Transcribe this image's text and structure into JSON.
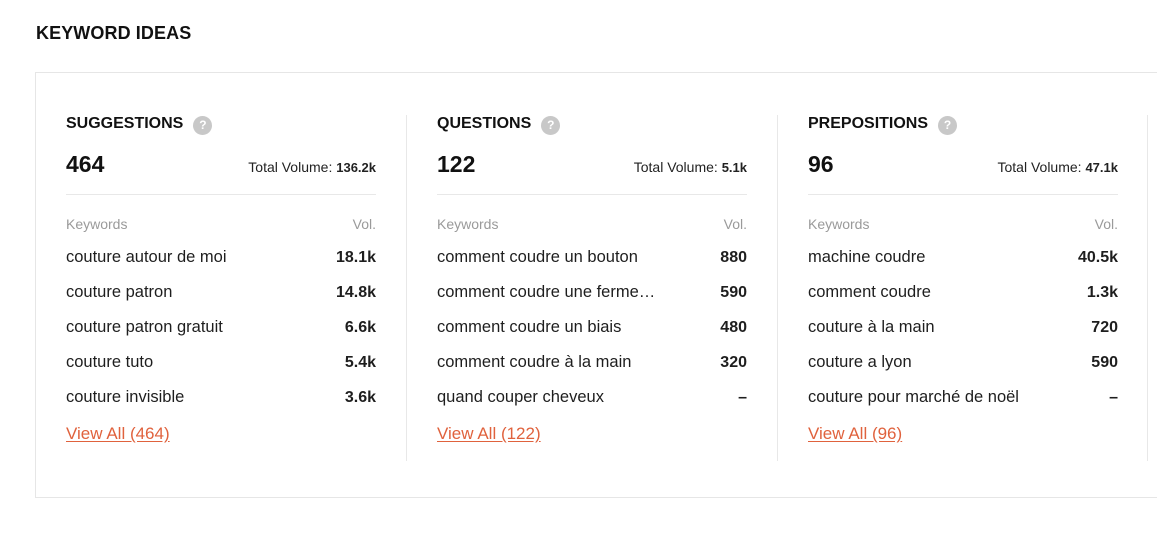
{
  "page": {
    "title": "KEYWORD IDEAS"
  },
  "common": {
    "total_label": "Total Volume:",
    "keywords_header": "Keywords",
    "vol_header": "Vol.",
    "help_glyph": "?"
  },
  "colors": {
    "link": "#e0623d",
    "help_icon": "#c8c8c8"
  },
  "columns": [
    {
      "title": "SUGGESTIONS",
      "count": "464",
      "total_volume": "136.2k",
      "rows": [
        {
          "keyword": "couture autour de moi",
          "volume": "18.1k"
        },
        {
          "keyword": "couture patron",
          "volume": "14.8k"
        },
        {
          "keyword": "couture patron gratuit",
          "volume": "6.6k"
        },
        {
          "keyword": "couture tuto",
          "volume": "5.4k"
        },
        {
          "keyword": "couture invisible",
          "volume": "3.6k"
        }
      ],
      "view_all": "View All (464)"
    },
    {
      "title": "QUESTIONS",
      "count": "122",
      "total_volume": "5.1k",
      "rows": [
        {
          "keyword": "comment coudre un bouton",
          "volume": "880"
        },
        {
          "keyword": "comment coudre une ferme…",
          "volume": "590"
        },
        {
          "keyword": "comment coudre un biais",
          "volume": "480"
        },
        {
          "keyword": "comment coudre à la main",
          "volume": "320"
        },
        {
          "keyword": "quand couper cheveux",
          "volume": "–"
        }
      ],
      "view_all": "View All (122)"
    },
    {
      "title": "PREPOSITIONS",
      "count": "96",
      "total_volume": "47.1k",
      "rows": [
        {
          "keyword": "machine coudre",
          "volume": "40.5k"
        },
        {
          "keyword": "comment coudre",
          "volume": "1.3k"
        },
        {
          "keyword": "couture à la main",
          "volume": "720"
        },
        {
          "keyword": "couture a lyon",
          "volume": "590"
        },
        {
          "keyword": "couture pour marché de noël",
          "volume": "–"
        }
      ],
      "view_all": "View All (96)"
    }
  ]
}
